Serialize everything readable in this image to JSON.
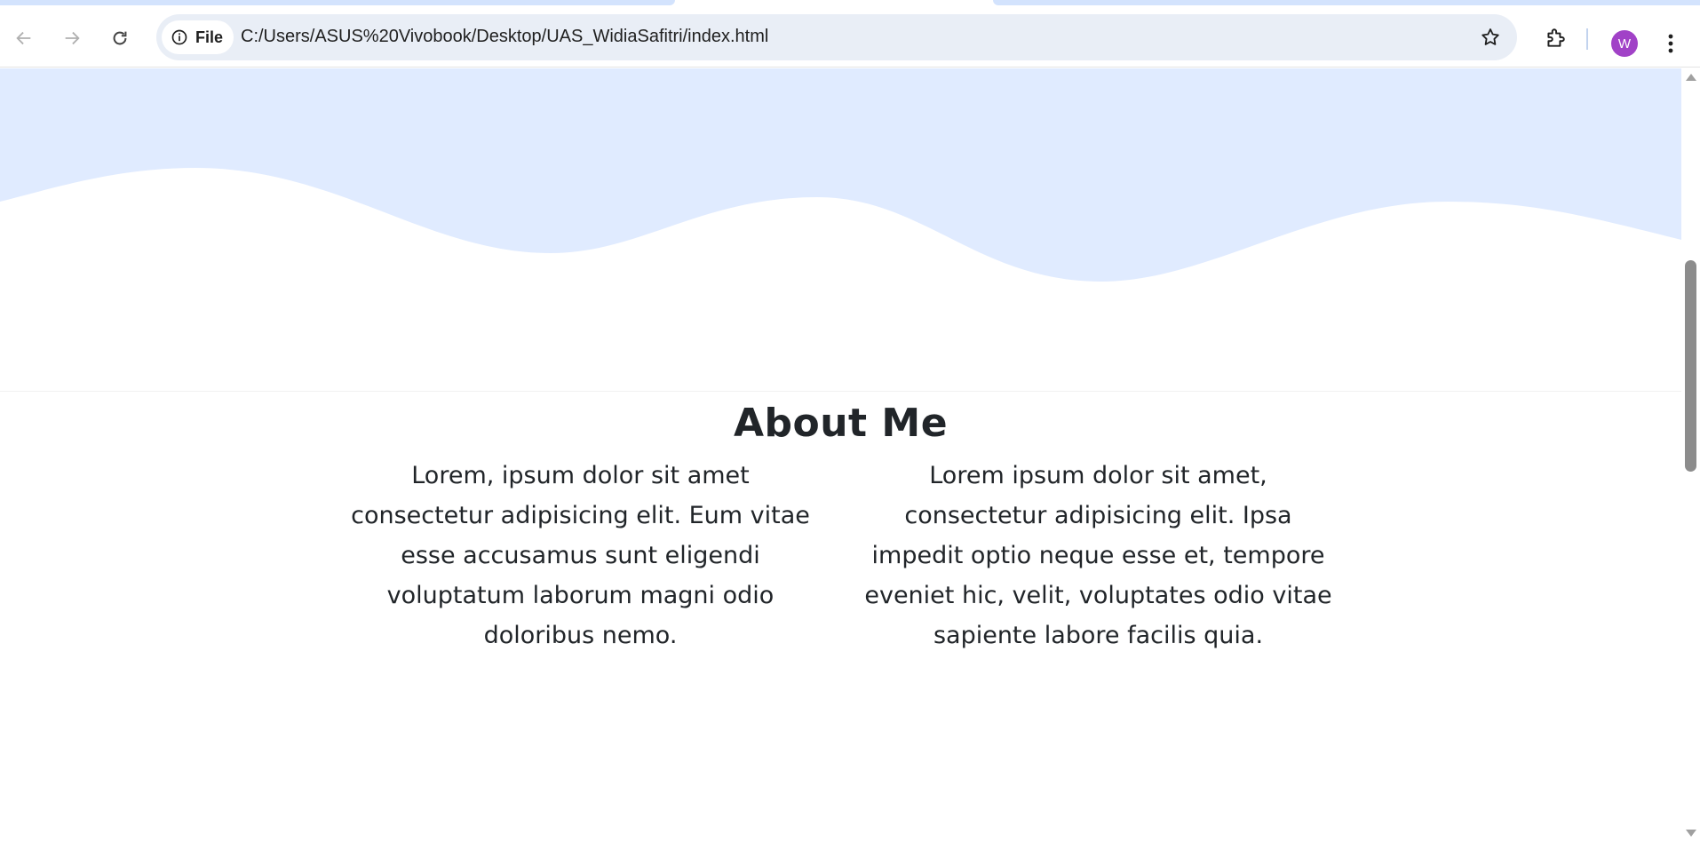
{
  "browser": {
    "site_chip_label": "File",
    "url": "C:/Users/ASUS%20Vivobook/Desktop/UAS_WidiaSafitri/index.html",
    "profile_initial": "W",
    "colors": {
      "avatar": "#a142c7",
      "omnibox": "#e9eef6",
      "tab_accent": "#d3e3fd"
    },
    "icons": [
      "back-arrow-icon",
      "forward-arrow-icon",
      "reload-icon",
      "info-icon",
      "star-icon",
      "extensions-icon",
      "kebab-menu-icon"
    ]
  },
  "page": {
    "colors": {
      "wave": "#e0ebff",
      "text": "#212529"
    },
    "about": {
      "title": "About Me",
      "col_left": "Lorem, ipsum dolor sit amet consectetur adipisicing elit. Eum vitae esse accusamus sunt eligendi voluptatum laborum magni odio doloribus nemo.",
      "col_right": "Lorem ipsum dolor sit amet, consectetur adipisicing elit. Ipsa impedit optio neque esse et, tempore eveniet hic, velit, voluptates odio vitae sapiente labore facilis quia."
    }
  }
}
